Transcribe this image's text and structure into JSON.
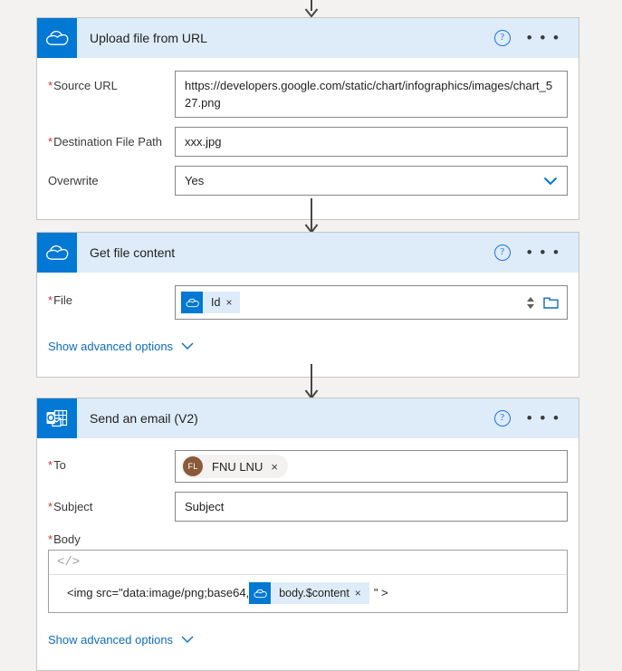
{
  "connectors": [
    {
      "name": "arrow-to-upload-file",
      "style": "arrowhead-only"
    },
    {
      "name": "arrow-upload-to-get-file",
      "style": "line-with-arrowhead"
    },
    {
      "name": "arrow-get-file-to-send-email",
      "style": "line-with-arrowhead"
    }
  ],
  "cards": {
    "upload": {
      "title": "Upload file from URL",
      "icon": "onedrive-icon",
      "help_label": "?",
      "menu_label": "• • •",
      "fields": {
        "source_url": {
          "label": "Source URL",
          "required": true,
          "value": "https://developers.google.com/static/chart/infographics/images/chart_527.png"
        },
        "destination_file_path": {
          "label": "Destination File Path",
          "required": true,
          "value": "xxx.jpg"
        },
        "overwrite": {
          "label": "Overwrite",
          "required": false,
          "value": "Yes",
          "chevron": "chevron-down-icon"
        }
      }
    },
    "getfile": {
      "title": "Get file content",
      "icon": "onedrive-icon",
      "help_label": "?",
      "menu_label": "• • •",
      "fields": {
        "file": {
          "label": "File",
          "required": true,
          "token": {
            "label": "Id",
            "icon": "onedrive-icon",
            "remove": "×"
          },
          "spinner": "spinner-arrows",
          "picker": "folder-icon"
        }
      },
      "advanced_options_label": "Show advanced options"
    },
    "sendemail": {
      "title": "Send an email (V2)",
      "icon": "outlook-icon",
      "help_label": "?",
      "menu_label": "• • •",
      "fields": {
        "to": {
          "label": "To",
          "required": true,
          "person": {
            "initials": "FL",
            "name": "FNU LNU",
            "remove": "×",
            "avatar_color": "#8a5a3b"
          }
        },
        "subject": {
          "label": "Subject",
          "required": true,
          "value": "Subject"
        },
        "body": {
          "label": "Body",
          "required": true,
          "toolbar_glyph": "</>",
          "code_prefix": "<img src=\"data:image/png;base64,",
          "token": {
            "label": "body.$content",
            "icon": "onedrive-icon",
            "remove": "×"
          },
          "code_suffix": "\" >"
        }
      },
      "advanced_options_label": "Show advanced options"
    }
  },
  "colors": {
    "accent": "#0078d4",
    "header_bg": "#deecf9",
    "page_bg": "#f3f2f1",
    "required_mark": "#d13438",
    "link": "#0f6cbd"
  }
}
